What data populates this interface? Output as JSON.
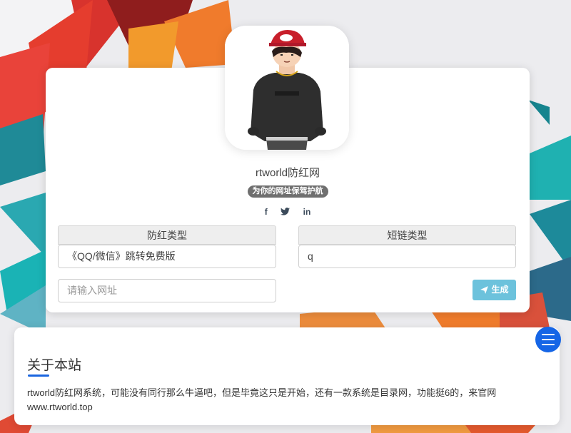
{
  "site": {
    "title": "rtworld防红网",
    "slogan": "为你的网址保驾护航"
  },
  "social": [
    {
      "icon": "facebook-icon",
      "label": "f"
    },
    {
      "icon": "twitter-icon",
      "label": "t"
    },
    {
      "icon": "linkedin-icon",
      "label": "in"
    }
  ],
  "form": {
    "anti_type": {
      "header": "防红类型",
      "value": "《QQ/微信》跳转免费版"
    },
    "link_type": {
      "header": "短链类型",
      "value": "q"
    },
    "url_input": {
      "placeholder": "请输入网址"
    },
    "generate_label": "生成"
  },
  "about": {
    "title": "关于本站",
    "text": "rtworld防红网系统，可能没有同行那么牛逼吧，但是毕竟这只是开始，还有一款系统是目录网，功能挺6的，来官网www.rtworld.top"
  },
  "colors": {
    "accent": "#1565e6",
    "button": "#6cc2dc",
    "badge": "#6f6f6f"
  }
}
